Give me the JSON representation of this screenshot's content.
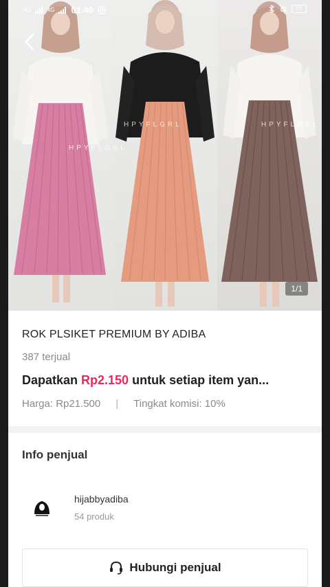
{
  "status_bar": {
    "network_1": "4G",
    "network_2": "4G",
    "time": "01.40",
    "battery": "53"
  },
  "hero": {
    "pager": "1/1",
    "watermark_1": "HPYFLGRL",
    "watermark_2": "HPYFLGRL",
    "watermark_3": "HPYFLGRL",
    "skirt_colors": [
      "#d77ea2",
      "#e59b7f",
      "#7f625b"
    ]
  },
  "product": {
    "title": "ROK PLSIKET PREMIUM BY ADIBA",
    "sold": "387 terjual",
    "earn_prefix": "Dapatkan ",
    "earn_amount": "Rp2.150",
    "earn_suffix": " untuk setiap item yan...",
    "price": "Harga: Rp21.500",
    "separator": "|",
    "commission": "Tingkat komisi: 10%"
  },
  "seller": {
    "heading": "Info penjual",
    "name": "hijabbyadiba",
    "products": "54 produk",
    "contact_label": "Hubungi penjual"
  },
  "icons": {
    "back": "chevron-left-icon",
    "contact": "headset-icon"
  },
  "colors": {
    "accent": "#e8295c"
  }
}
